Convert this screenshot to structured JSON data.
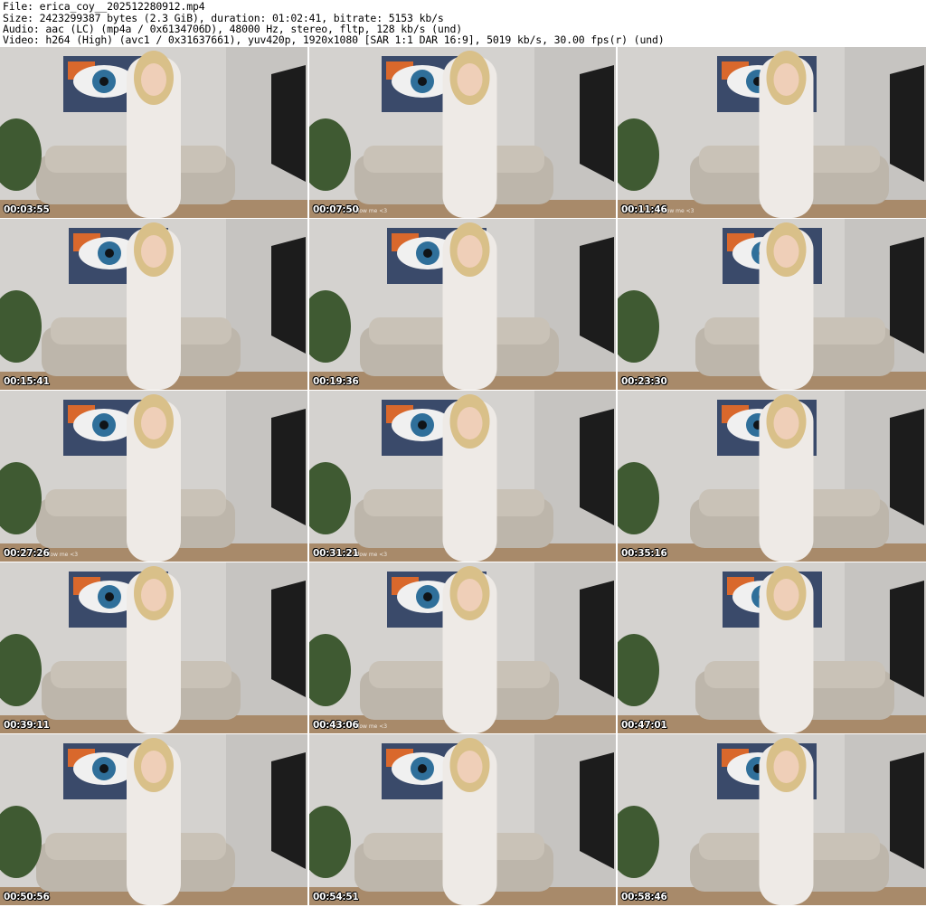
{
  "header": {
    "file_line": "File: erica_coy__202512280912.mp4",
    "size_line": "Size: 2423299387 bytes (2.3 GiB), duration: 01:02:41, bitrate: 5153 kb/s",
    "audio_line": "Audio: aac (LC) (mp4a / 0x6134706D), 48000 Hz, stereo, fltp, 128 kb/s (und)",
    "video_line": "Video: h264 (High) (avc1 / 0x31637661), yuv420p, 1920x1080 [SAR 1:1 DAR 16:9], 5019 kb/s, 30.00 fps(r) (und)"
  },
  "thumbnails": [
    {
      "timestamp": "00:03:55"
    },
    {
      "timestamp": "00:07:50",
      "watermark": "llow me <3"
    },
    {
      "timestamp": "00:11:46",
      "watermark": "low me <3"
    },
    {
      "timestamp": "00:15:41"
    },
    {
      "timestamp": "00:19:36"
    },
    {
      "timestamp": "00:23:30"
    },
    {
      "timestamp": "00:27:26",
      "watermark": "llow me <3"
    },
    {
      "timestamp": "00:31:21",
      "watermark": "llow me <3"
    },
    {
      "timestamp": "00:35:16"
    },
    {
      "timestamp": "00:39:11"
    },
    {
      "timestamp": "00:43:06",
      "watermark": "llow me <3"
    },
    {
      "timestamp": "00:47:01"
    },
    {
      "timestamp": "00:50:56"
    },
    {
      "timestamp": "00:54:51"
    },
    {
      "timestamp": "00:58:46"
    }
  ]
}
